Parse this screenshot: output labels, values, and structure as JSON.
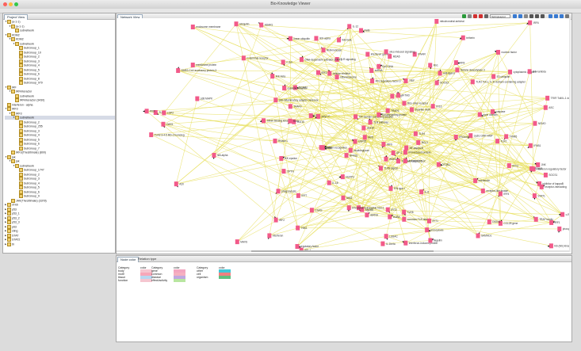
{
  "window": {
    "title": "Bio-Knowledge Viewer"
  },
  "project_view": {
    "tab_label": "Project View",
    "items": [
      {
        "indent": 0,
        "tw": "▼",
        "label": "(a-1-1)"
      },
      {
        "indent": 1,
        "tw": "▼",
        "label": "(a-1-1)"
      },
      {
        "indent": 2,
        "tw": "",
        "label": "subnetwork"
      },
      {
        "indent": 0,
        "tw": "▼",
        "label": "KDM2"
      },
      {
        "indent": 1,
        "tw": "▼",
        "label": "KDM2"
      },
      {
        "indent": 2,
        "tw": "▼",
        "label": "subnetwork"
      },
      {
        "indent": 3,
        "tw": "",
        "label": "SubGroup_1"
      },
      {
        "indent": 3,
        "tw": "",
        "label": "SubGroup_10"
      },
      {
        "indent": 3,
        "tw": "",
        "label": "SubGroup_2"
      },
      {
        "indent": 3,
        "tw": "",
        "label": "SubGroup_3"
      },
      {
        "indent": 3,
        "tw": "",
        "label": "SubGroup_4"
      },
      {
        "indent": 3,
        "tw": "",
        "label": "SubGroup_5"
      },
      {
        "indent": 3,
        "tw": "",
        "label": "SubGroup_6"
      },
      {
        "indent": 3,
        "tw": "",
        "label": "SubGroup_8"
      },
      {
        "indent": 3,
        "tw": "",
        "label": "SubGroup_979"
      },
      {
        "indent": 0,
        "tw": "▼",
        "label": "IRF"
      },
      {
        "indent": 1,
        "tw": "▼",
        "label": "IRFinteractor"
      },
      {
        "indent": 2,
        "tw": "",
        "label": "subnetwork"
      },
      {
        "indent": 2,
        "tw": "",
        "label": "IRFinteractor (3430)"
      },
      {
        "indent": 0,
        "tw": "",
        "label": "interferon - alpha"
      },
      {
        "indent": 0,
        "tw": "▼",
        "label": "IRF3"
      },
      {
        "indent": 1,
        "tw": "▼",
        "label": "IRF3"
      },
      {
        "indent": 2,
        "tw": "▼",
        "label": "subnetwork"
      },
      {
        "indent": 3,
        "tw": "",
        "label": "SubGroup_2"
      },
      {
        "indent": 3,
        "tw": "",
        "label": "SubGroup_255"
      },
      {
        "indent": 3,
        "tw": "",
        "label": "SubGroup_3"
      },
      {
        "indent": 3,
        "tw": "",
        "label": "SubGroup_4"
      },
      {
        "indent": 3,
        "tw": "",
        "label": "SubGroup_5"
      },
      {
        "indent": 3,
        "tw": "",
        "label": "SubGroup_6"
      },
      {
        "indent": 3,
        "tw": "",
        "label": "SubGroup_7"
      },
      {
        "indent": 1,
        "tw": "",
        "label": "IRF3(TheUltimate) (800)"
      },
      {
        "indent": 0,
        "tw": "▼",
        "label": "jak"
      },
      {
        "indent": 1,
        "tw": "▼",
        "label": "jak"
      },
      {
        "indent": 2,
        "tw": "▼",
        "label": "subnetwork"
      },
      {
        "indent": 3,
        "tw": "",
        "label": "SubGroup_1747"
      },
      {
        "indent": 3,
        "tw": "",
        "label": "SubGroup_2"
      },
      {
        "indent": 3,
        "tw": "",
        "label": "SubGroup_3"
      },
      {
        "indent": 3,
        "tw": "",
        "label": "SubGroup_4"
      },
      {
        "indent": 3,
        "tw": "",
        "label": "SubGroup_5"
      },
      {
        "indent": 3,
        "tw": "",
        "label": "SubGroup_6"
      },
      {
        "indent": 3,
        "tw": "",
        "label": "SubGroup_9"
      },
      {
        "indent": 1,
        "tw": "",
        "label": "JAK(TheUltimate) (3378)"
      },
      {
        "indent": 0,
        "tw": "▶",
        "label": "nf-kb"
      },
      {
        "indent": 0,
        "tw": "▶",
        "label": "p53"
      },
      {
        "indent": 0,
        "tw": "▶",
        "label": "p53_1"
      },
      {
        "indent": 0,
        "tw": "▶",
        "label": "p53_2"
      },
      {
        "indent": 0,
        "tw": "▶",
        "label": "p53_3"
      },
      {
        "indent": 0,
        "tw": "▶",
        "label": "p63"
      },
      {
        "indent": 0,
        "tw": "▶",
        "label": "sting"
      },
      {
        "indent": 0,
        "tw": "▶",
        "label": "STAT"
      },
      {
        "indent": 0,
        "tw": "▶",
        "label": "STAT2"
      },
      {
        "indent": 0,
        "tw": "▶",
        "label": "tlr"
      }
    ]
  },
  "network_view": {
    "tab_label": "Network View",
    "layout_select": "SpringLayout",
    "labels": [
      "anti-ligand",
      "IFN-induced protein",
      "interferon regulatory factor",
      "IFN-inducible IGH-1",
      "TLR2 3-4-5 MD-2 homolog",
      "TLR2 Toll 1, II, III domain-containing adapter",
      "TLR signaling",
      "Ikb (Ikb) kinase",
      "interferon-induced protein",
      "Toll-like receptor TLR",
      "C-terminal receptor",
      "IRF3",
      "IFN-regulatory factor 3",
      "anti-inflammatory adapter molecule",
      "TRIF/ Toll/IL-1 domain-containing adapter",
      "cellular inhibitor",
      "IRF7",
      "SARS-CoV accessory protein 3",
      "DNA-dependent activator of IRFs",
      "interleukin",
      "TANK-binding kinase 1",
      "common TLR adapter",
      "RIG-I-like receptor",
      "E3 ubiquitin",
      "CCL28 gene",
      "TRAF family",
      "NF-kappa-B",
      "TLR pathway",
      "IFN type I",
      "MAVS",
      "TLR9 signal",
      "IPS-1",
      "STING",
      "CGAS",
      "Ubiquitin",
      "receptor-like kinase",
      "cytoplasmic adapter",
      "endosome membrane",
      "IKK-epsilon",
      "nuclear factor",
      "TRAF3",
      "ISG15",
      "MyD88",
      "RNA helicase",
      "TLR3",
      "TLR4",
      "TLR7",
      "interferon",
      "TRIF",
      "TBK1",
      "TICAM1",
      "OPTN",
      "IRAK4",
      "TIR domain-containing adapter",
      "inhibitor of kappaB",
      "receptor-interacting",
      "phosphoinositide kinase PI3K",
      "IL-6",
      "IFNB1",
      "TLR8",
      "regulatory factor",
      "tripartite motif",
      "cyclic GMP-AMP",
      "STAT1",
      "IRF9",
      "IFNAR",
      "membrane protein",
      "interferon gamma",
      "IL-12",
      "IL-18",
      "caspase",
      "TRAF6",
      "p38 MAPK",
      "JNK",
      "ERK",
      "AP-1",
      "c-Jun",
      "pattern recognition",
      "LGP2",
      "MDA5",
      "DDX41",
      "IFI16",
      "AIM2",
      "NLRP3",
      "ASC",
      "pyrin domain",
      "inflammasome",
      "IL-1beta",
      "Toll-interacting protein",
      "SOCS1",
      "SOCS3",
      "A20",
      "CYLD",
      "OTUB1",
      "DUBA",
      "USP25",
      "linear ubiquitin",
      "LUBAC",
      "NEMO",
      "IKK-alpha",
      "IKK-beta",
      "RelA",
      "c-Rel",
      "RelB",
      "NFKB1",
      "NFKB2",
      "IkB-alpha",
      "IkB-beta",
      "BCL3",
      "histone deacetylase 3",
      "IRF5",
      "IRF1",
      "IRF2",
      "IRF4",
      "IRF6",
      "IRF8",
      "cytokine receptor",
      "virus-induced signaling",
      "mitochondrial antiviral",
      "LPS",
      "peptidoglycan",
      "flagellin",
      "CpG DNA",
      "poly I:C",
      "ssRNA",
      "dsRNA",
      "endocytosis",
      "phagocytosis",
      "IFN-alpha",
      "IFN-beta",
      "IFN-lambda",
      "IFITM3",
      "Mx1",
      "OAS1",
      "PKR",
      "RNase L",
      "ADAR1",
      "APOBEC3G",
      "TRIM5",
      "tetherin",
      "SAMHD1",
      "viperin",
      "IFIT1",
      "IFIT2",
      "IFIT3"
    ]
  },
  "bottom_panel": {
    "tabs": [
      "Node color",
      "Relation type"
    ],
    "columns": [
      {
        "header": "Category",
        "color_header": "color",
        "rows": [
          "body",
          "motif",
          "tissue",
          "function"
        ]
      },
      {
        "header": "Category",
        "color_header": "color",
        "rows": [
          "gene",
          "common",
          "disease",
          "effect/activity"
        ]
      },
      {
        "header": "Category",
        "color_header": "color",
        "rows": [
          "other",
          "cell",
          "organism"
        ]
      }
    ],
    "colors": {
      "body": "#f5c6d0",
      "motif": "#f7a7b8",
      "tissue": "#b8d8f0",
      "function": "#f5c6d0",
      "gene": "#f4a6c0",
      "common": "#f6b0c0",
      "disease": "#c0a8e0",
      "effect/activity": "#b8e6a0",
      "other": "#40c8d8",
      "cell": "#f08080",
      "organism": "#60c080"
    }
  },
  "colors": {
    "edge": "#e8e060",
    "node": "#f25a8a",
    "arrow": "#000000"
  }
}
